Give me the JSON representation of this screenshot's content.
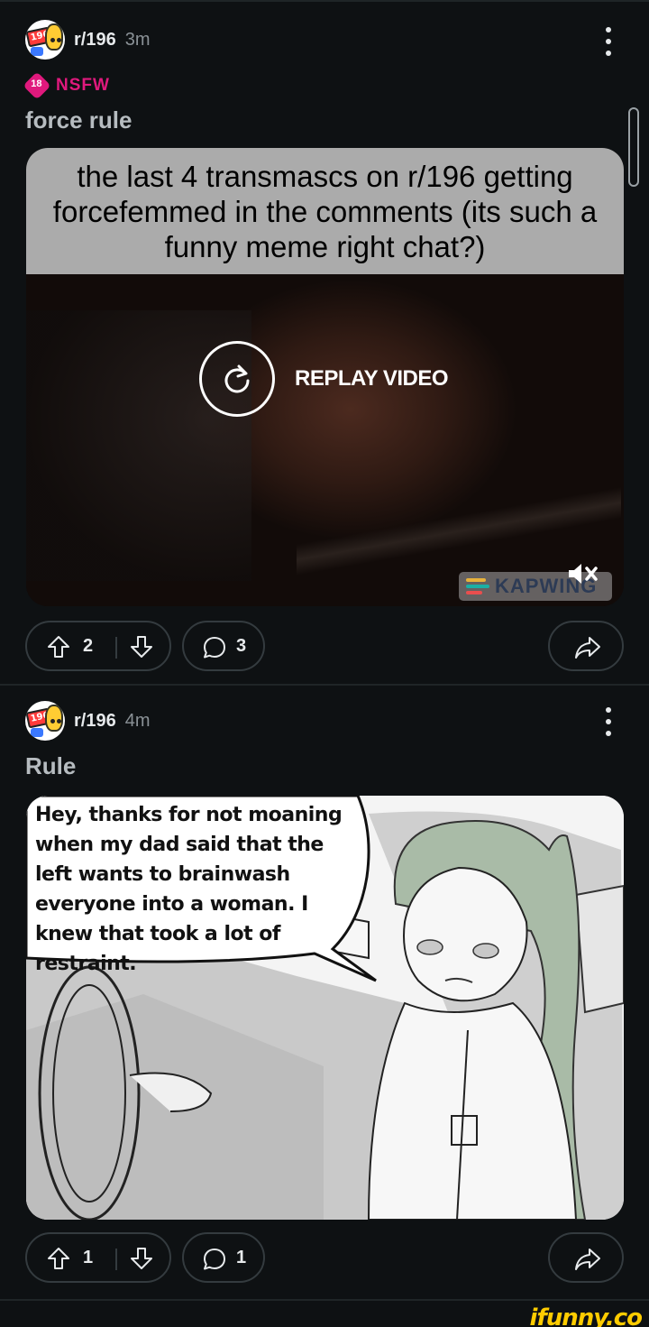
{
  "colors": {
    "background": "#0e1113",
    "nsfw": "#e0197d",
    "pill_border": "#343b3f",
    "ifunny": "#ffcc00"
  },
  "posts": [
    {
      "subreddit": "r/196",
      "age": "3m",
      "nsfw_badge": "18",
      "nsfw_label": "NSFW",
      "title": "force rule",
      "caption": "the last 4 transmascs on r/196 getting forcefemmed in the comments (its such a funny meme right chat?)",
      "replay_label": "REPLAY VIDEO",
      "watermark": "KAPWING",
      "upvotes": "2",
      "comments": "3"
    },
    {
      "subreddit": "r/196",
      "age": "4m",
      "title": "Rule",
      "comic_text": "Hey, thanks for not moaning when my dad said that the left wants to brainwash everyone into a woman. I knew that took a lot of restraint.",
      "upvotes": "1",
      "comments": "1"
    }
  ],
  "footer": {
    "brand": "ifunny.co"
  }
}
